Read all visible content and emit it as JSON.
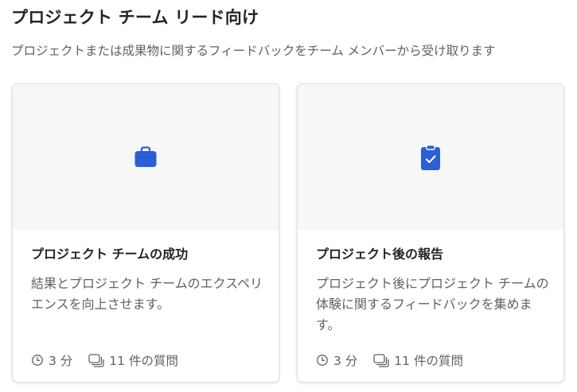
{
  "header": {
    "title": "プロジェクト チーム リード向け",
    "subtitle": "プロジェクトまたは成果物に関するフィードバックをチーム メンバーから受け取ります"
  },
  "cards": [
    {
      "icon": "briefcase-icon",
      "title": "プロジェクト チームの成功",
      "description": "結果とプロジェクト チームのエクスペリエンスを向上させます。",
      "duration": "3 分",
      "questions": "11 件の質問"
    },
    {
      "icon": "clipboard-check-icon",
      "title": "プロジェクト後の報告",
      "description": "プロジェクト後にプロジェクト チームの体験に関するフィードバックを集めます。",
      "duration": "3 分",
      "questions": "11 件の質問"
    }
  ],
  "colors": {
    "accent": "#2b5fd6",
    "hero_background": "#f7f7f7",
    "secondary_text": "#616161"
  }
}
